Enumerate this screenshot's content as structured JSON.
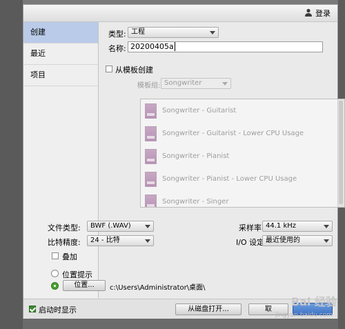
{
  "header": {
    "login_label": "登录"
  },
  "sidebar": {
    "items": [
      {
        "label": "创建"
      },
      {
        "label": "最近"
      },
      {
        "label": "项目"
      }
    ]
  },
  "form": {
    "type_label": "类型:",
    "type_value": "工程",
    "name_label": "名称:",
    "name_value": "20200405a",
    "from_template_label": "从模板创建",
    "template_group_label": "模板组:",
    "template_group_value": "Songwriter"
  },
  "templates": [
    {
      "label": "Songwriter - Guitarist"
    },
    {
      "label": "Songwriter - Guitarist - Lower CPU Usage"
    },
    {
      "label": "Songwriter - Pianist"
    },
    {
      "label": "Songwriter - Pianist - Lower CPU Usage"
    },
    {
      "label": "Songwriter - Singer"
    }
  ],
  "settings": {
    "file_type_label": "文件类型:",
    "file_type_value": "BWF (.WAV)",
    "sample_rate_label": "采样率:",
    "sample_rate_value": "44.1 kHz",
    "bit_depth_label": "比特精度:",
    "bit_depth_value": "24 - 比特",
    "io_label": "I/O 设定:",
    "io_value": "最近使用的",
    "overlay_label": "叠加"
  },
  "location": {
    "hint_label": "位置提示",
    "location_button": "位置...",
    "path": "c:\\Users\\Administrator\\桌面\\"
  },
  "footer": {
    "show_on_start_label": "启动时显示",
    "open_from_disk_label": "从磁盘打开...",
    "browse_label": "取",
    "watermark": "Bai 经验",
    "watermark_url": "jingyan.baidu.com"
  }
}
